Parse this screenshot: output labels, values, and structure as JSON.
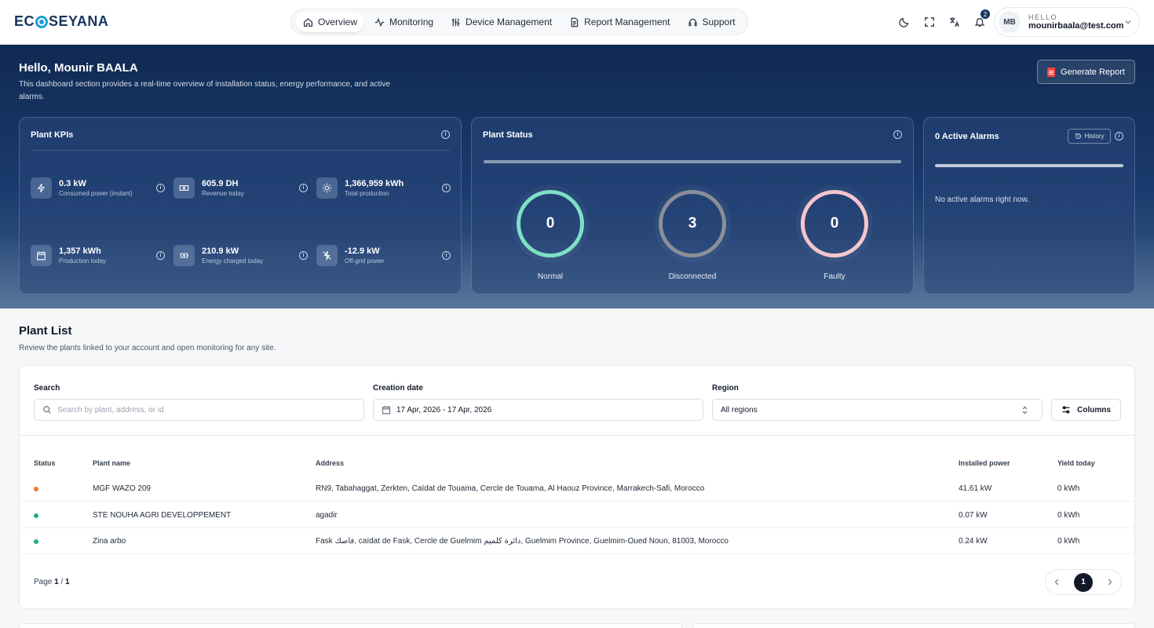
{
  "brand": {
    "prefix": "EC",
    "suffix": "SEYANA"
  },
  "nav": [
    {
      "label": "Overview",
      "icon": "home-icon",
      "active": true
    },
    {
      "label": "Monitoring",
      "icon": "activity-icon"
    },
    {
      "label": "Device Management",
      "icon": "sliders-icon"
    },
    {
      "label": "Report Management",
      "icon": "document-icon"
    },
    {
      "label": "Support",
      "icon": "headset-icon"
    }
  ],
  "tools": {
    "notifications_count": "2"
  },
  "user": {
    "initials": "MB",
    "hello": "HELLO",
    "email": "mounirbaala@test.com"
  },
  "hero": {
    "greeting": "Hello, Mounir BAALA",
    "description": "This dashboard section provides a real-time overview of installation status, energy performance, and active alarms.",
    "generate_label": "Generate Report"
  },
  "kpis": {
    "title": "Plant KPIs",
    "items": [
      {
        "value": "0.3 kW",
        "label": "Consumed power (instant)",
        "icon": "lightning-icon"
      },
      {
        "value": "605.9 DH",
        "label": "Revenue today",
        "icon": "cash-icon"
      },
      {
        "value": "1,366,959 kWh",
        "label": "Total production",
        "icon": "sun-icon"
      },
      {
        "value": "1,357 kWh",
        "label": "Production today",
        "icon": "calendar-icon"
      },
      {
        "value": "210.9 kW",
        "label": "Energy charged today",
        "icon": "battery-charge-icon"
      },
      {
        "value": "-12.9 kW",
        "label": "Off-grid power",
        "icon": "off-grid-icon"
      }
    ]
  },
  "status": {
    "title": "Plant Status",
    "items": [
      {
        "count": "0",
        "label": "Normal",
        "color": "#7ee0c4"
      },
      {
        "count": "3",
        "label": "Disconnected",
        "color": "#8b8f97"
      },
      {
        "count": "0",
        "label": "Faulty",
        "color": "#f4c6cf"
      }
    ]
  },
  "alarms": {
    "title": "0 Active Alarms",
    "history_label": "History",
    "empty": "No active alarms right now."
  },
  "plant_list": {
    "title": "Plant List",
    "description": "Review the plants linked to your account and open monitoring for any site.",
    "filters": {
      "search_label": "Search",
      "search_placeholder": "Search by plant, address, or id",
      "date_label": "Creation date",
      "date_value": "17 Apr, 2026 - 17 Apr, 2026",
      "region_label": "Region",
      "region_value": "All regions",
      "columns_label": "Columns"
    },
    "columns": [
      "Status",
      "Plant name",
      "Address",
      "Installed power",
      "Yield today"
    ],
    "rows": [
      {
        "status_color": "#ea7a2c",
        "name": "MGF WAZO 209",
        "address": "RN9, Tabahaggat, Zerkten, Caïdat de Touama, Cercle de Touama, Al Haouz Province, Marrakech-Safi, Morocco",
        "power": "41.61 kW",
        "yield": "0 kWh"
      },
      {
        "status_color": "#22b07d",
        "name": "STE NOUHA AGRI DEVELOPPEMENT",
        "address": "agadir",
        "power": "0.07 kW",
        "yield": "0 kWh"
      },
      {
        "status_color": "#22b07d",
        "name": "Zina arbo",
        "address": "Fask فاصك, caïdat de Fask, Cercle de Guelmim دائرة كلميم, Guelmim Province, Guelmim-Oued Noun, 81003, Morocco",
        "power": "0.24 kW",
        "yield": "0 kWh"
      }
    ],
    "pagination": {
      "page_word": "Page",
      "current": "1",
      "separator": "/",
      "total": "1"
    }
  }
}
